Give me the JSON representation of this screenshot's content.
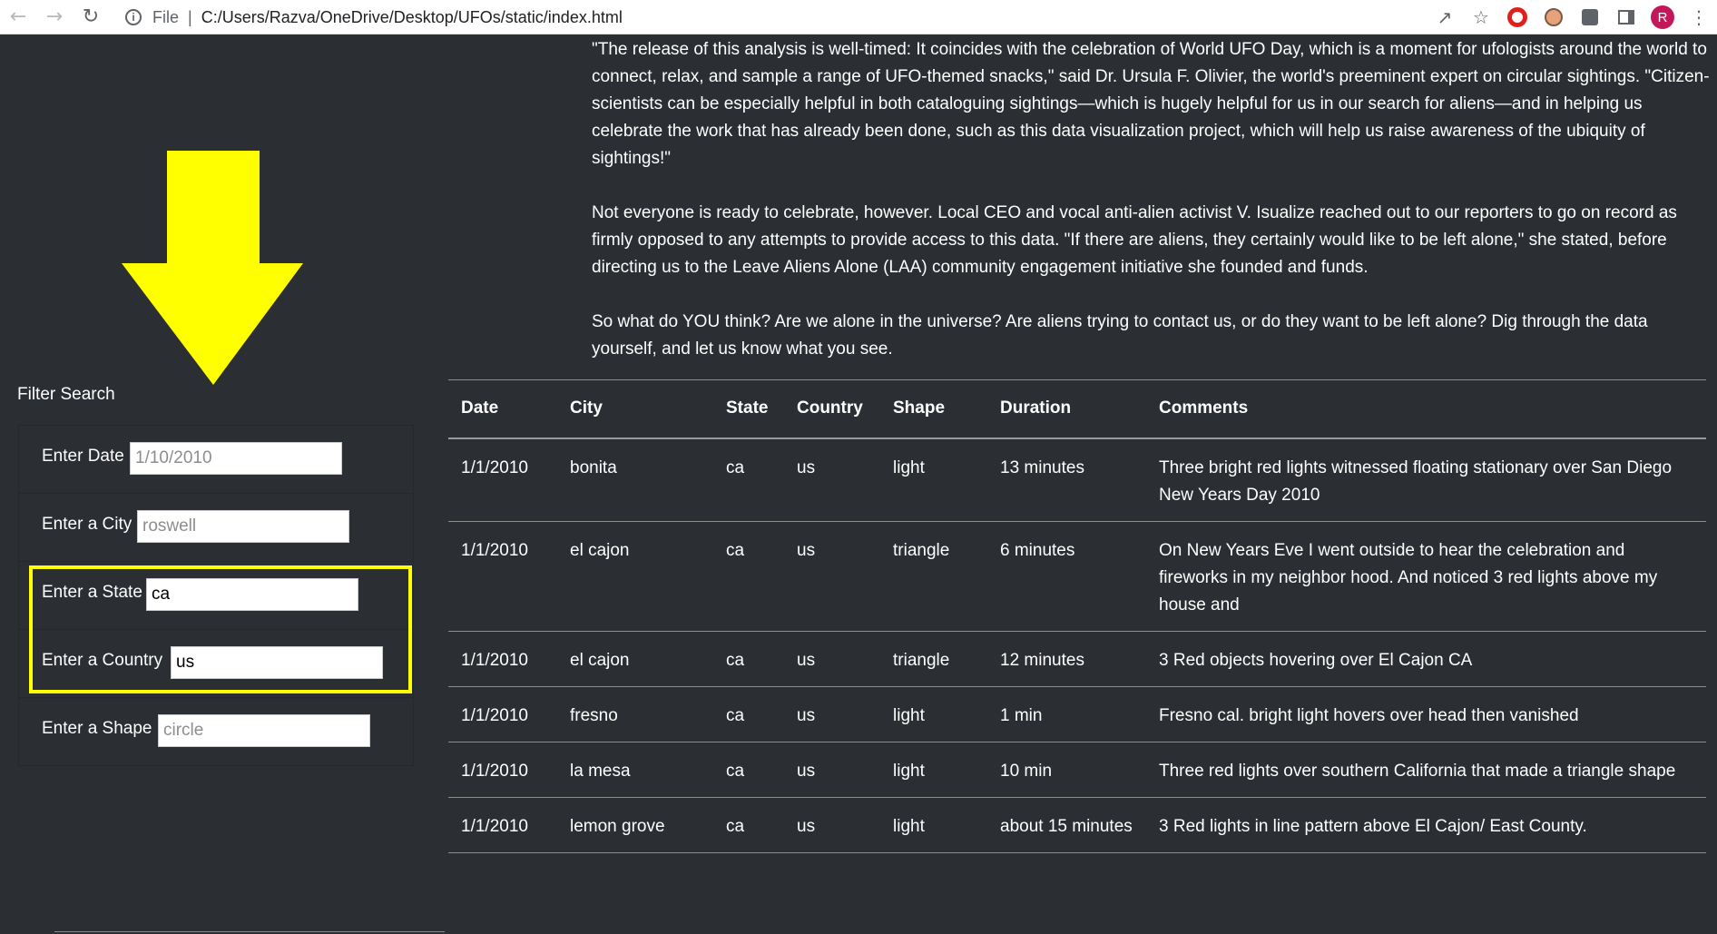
{
  "browser": {
    "address_scheme": "File",
    "address_path": "C:/Users/Razva/OneDrive/Desktop/UFOs/static/index.html",
    "profile_initial": "R"
  },
  "filters": {
    "title": "Filter Search",
    "date": {
      "label": "Enter Date",
      "value": "",
      "placeholder": "1/10/2010"
    },
    "city": {
      "label": "Enter a City",
      "value": "",
      "placeholder": "roswell"
    },
    "state": {
      "label": "Enter a State",
      "value": "ca",
      "placeholder": ""
    },
    "country": {
      "label": "Enter a Country",
      "value": "us",
      "placeholder": ""
    },
    "shape": {
      "label": "Enter a Shape",
      "value": "",
      "placeholder": "circle"
    }
  },
  "annotations": {
    "arrow_color": "#ffff00",
    "highlight_color": "#ffff00"
  },
  "story": {
    "p1": "\"The release of this analysis is well-timed: It coincides with the celebration of World UFO Day, which is a moment for ufologists around the world to connect, relax, and sample a range of UFO-themed snacks,\" said Dr. Ursula F. Olivier, the world's preeminent expert on circular sightings. \"Citizen-scientists can be especially helpful in both cataloguing sightings—which is hugely helpful for us in our search for aliens—and in helping us celebrate the work that has already been done, such as this data visualization project, which will help us raise awareness of the ubiquity of sightings!\"",
    "p2": "Not everyone is ready to celebrate, however. Local CEO and vocal anti-alien activist V. Isualize reached out to our reporters to go on record as firmly opposed to any attempts to provide access to this data. \"If there are aliens, they certainly would like to be left alone,\" she stated, before directing us to the Leave Aliens Alone (LAA) community engagement initiative she founded and funds.",
    "p3": "So what do YOU think? Are we alone in the universe? Are aliens trying to contact us, or do they want to be left alone? Dig through the data yourself, and let us know what you see."
  },
  "table": {
    "headers": [
      "Date",
      "City",
      "State",
      "Country",
      "Shape",
      "Duration",
      "Comments"
    ],
    "rows": [
      [
        "1/1/2010",
        "bonita",
        "ca",
        "us",
        "light",
        "13 minutes",
        "Three bright red lights witnessed floating stationary over San Diego New Years Day 2010"
      ],
      [
        "1/1/2010",
        "el cajon",
        "ca",
        "us",
        "triangle",
        "6 minutes",
        "On New Years Eve I went outside to hear the celebration and fireworks in my neighbor hood. And noticed 3 red lights above my house and"
      ],
      [
        "1/1/2010",
        "el cajon",
        "ca",
        "us",
        "triangle",
        "12 minutes",
        "3 Red objects hovering over El Cajon CA"
      ],
      [
        "1/1/2010",
        "fresno",
        "ca",
        "us",
        "light",
        "1 min",
        "Fresno cal. bright light hovers over head then vanished"
      ],
      [
        "1/1/2010",
        "la mesa",
        "ca",
        "us",
        "light",
        "10 min",
        "Three red lights over southern California that made a triangle shape"
      ],
      [
        "1/1/2010",
        "lemon grove",
        "ca",
        "us",
        "light",
        "about 15 minutes",
        "3 Red lights in line pattern above El Cajon/ East County."
      ]
    ]
  }
}
